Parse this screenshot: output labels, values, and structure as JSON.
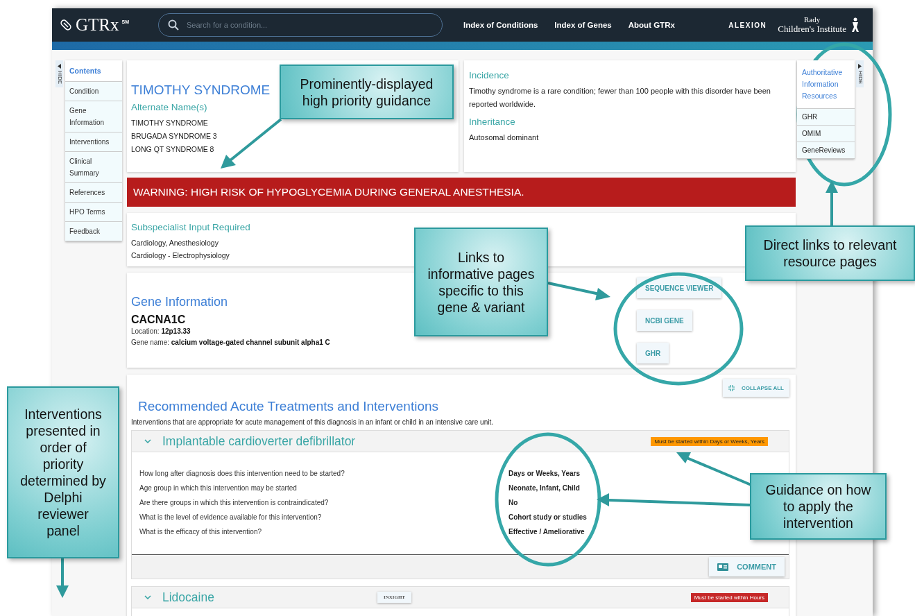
{
  "header": {
    "logo": "GTRx",
    "logo_mark": "SM",
    "search": {
      "placeholder": "Search for a condition..."
    },
    "nav": [
      "Index of Conditions",
      "Index of Genes",
      "About GTRx"
    ],
    "partner": "ALEXION",
    "institute_top": "Rady",
    "institute": "Children's Institute"
  },
  "contents_nav": {
    "hide_label": "HIDE",
    "title": "Contents",
    "items": [
      "Condition",
      "Gene Information",
      "Interventions",
      "Clinical Summary",
      "References",
      "HPO Terms",
      "Feedback"
    ]
  },
  "condition": {
    "title": "TIMOTHY SYNDROME",
    "alternate_heading": "Alternate Name(s)",
    "alternate_names": [
      "TIMOTHY SYNDROME",
      "BRUGADA SYNDROME 3",
      "LONG QT SYNDROME 8"
    ]
  },
  "summary": {
    "incidence_heading": "Incidence",
    "incidence": "Timothy syndrome is a rare condition; fewer than 100 people with this disorder have been reported worldwide.",
    "inheritance_heading": "Inheritance",
    "inheritance": "Autosomal dominant"
  },
  "warning": "WARNING: HIGH RISK OF HYPOGLYCEMIA DURING GENERAL ANESTHESIA.",
  "subspecialist": {
    "heading": "Subspecialist Input Required",
    "items": [
      "Cardiology, Anesthesiology",
      "Cardiology - Electrophysiology"
    ]
  },
  "gene": {
    "heading": "Gene Information",
    "symbol": "CACNA1C",
    "location_label": "Location:",
    "location": "12p13.33",
    "name_label": "Gene name:",
    "name": "calcium voltage-gated channel subunit alpha1 C",
    "links": [
      "SEQUENCE VIEWER",
      "NCBI GENE",
      "GHR"
    ]
  },
  "interventions": {
    "title": "Recommended Acute Treatments and Interventions",
    "collapse_label": "COLLAPSE ALL",
    "intro": "Interventions that are appropriate for acute management of this diagnosis in an infant or child in an intensive care unit.",
    "items": [
      {
        "name": "Implantable cardioverter defibrillator",
        "deadline": "Must be started within Days or Weeks, Years",
        "color": "#ff9800",
        "comment": "COMMENT",
        "questions": [
          {
            "q": "How long after diagnosis does this intervention need to be started?",
            "a": "Days or Weeks, Years"
          },
          {
            "q": "Age group in which this intervention may be started",
            "a": "Neonate, Infant, Child"
          },
          {
            "q": "Are there groups in which this intervention is contraindicated?",
            "a": "No"
          },
          {
            "q": "What is the level of evidence available for this intervention?",
            "a": "Cohort study or studies"
          },
          {
            "q": "What is the efficacy of this intervention?",
            "a": "Effective / Ameliorative"
          }
        ]
      },
      {
        "name": "Lidocaine",
        "tag": "INXIGHT",
        "deadline": "Must be started within Hours",
        "color": "#c62828"
      }
    ]
  },
  "resources": {
    "hide_label": "HIDE",
    "title": "Authoritative Information Resources",
    "items": [
      "GHR",
      "OMIM",
      "GeneReviews"
    ]
  },
  "annotations": [
    "Prominently-displayed high priority guidance",
    "Links to informative pages specific to this gene & variant",
    "Direct links to relevant resource pages",
    "Interventions presented in order of priority determined by Delphi reviewer panel",
    "Guidance on how to apply the intervention"
  ]
}
